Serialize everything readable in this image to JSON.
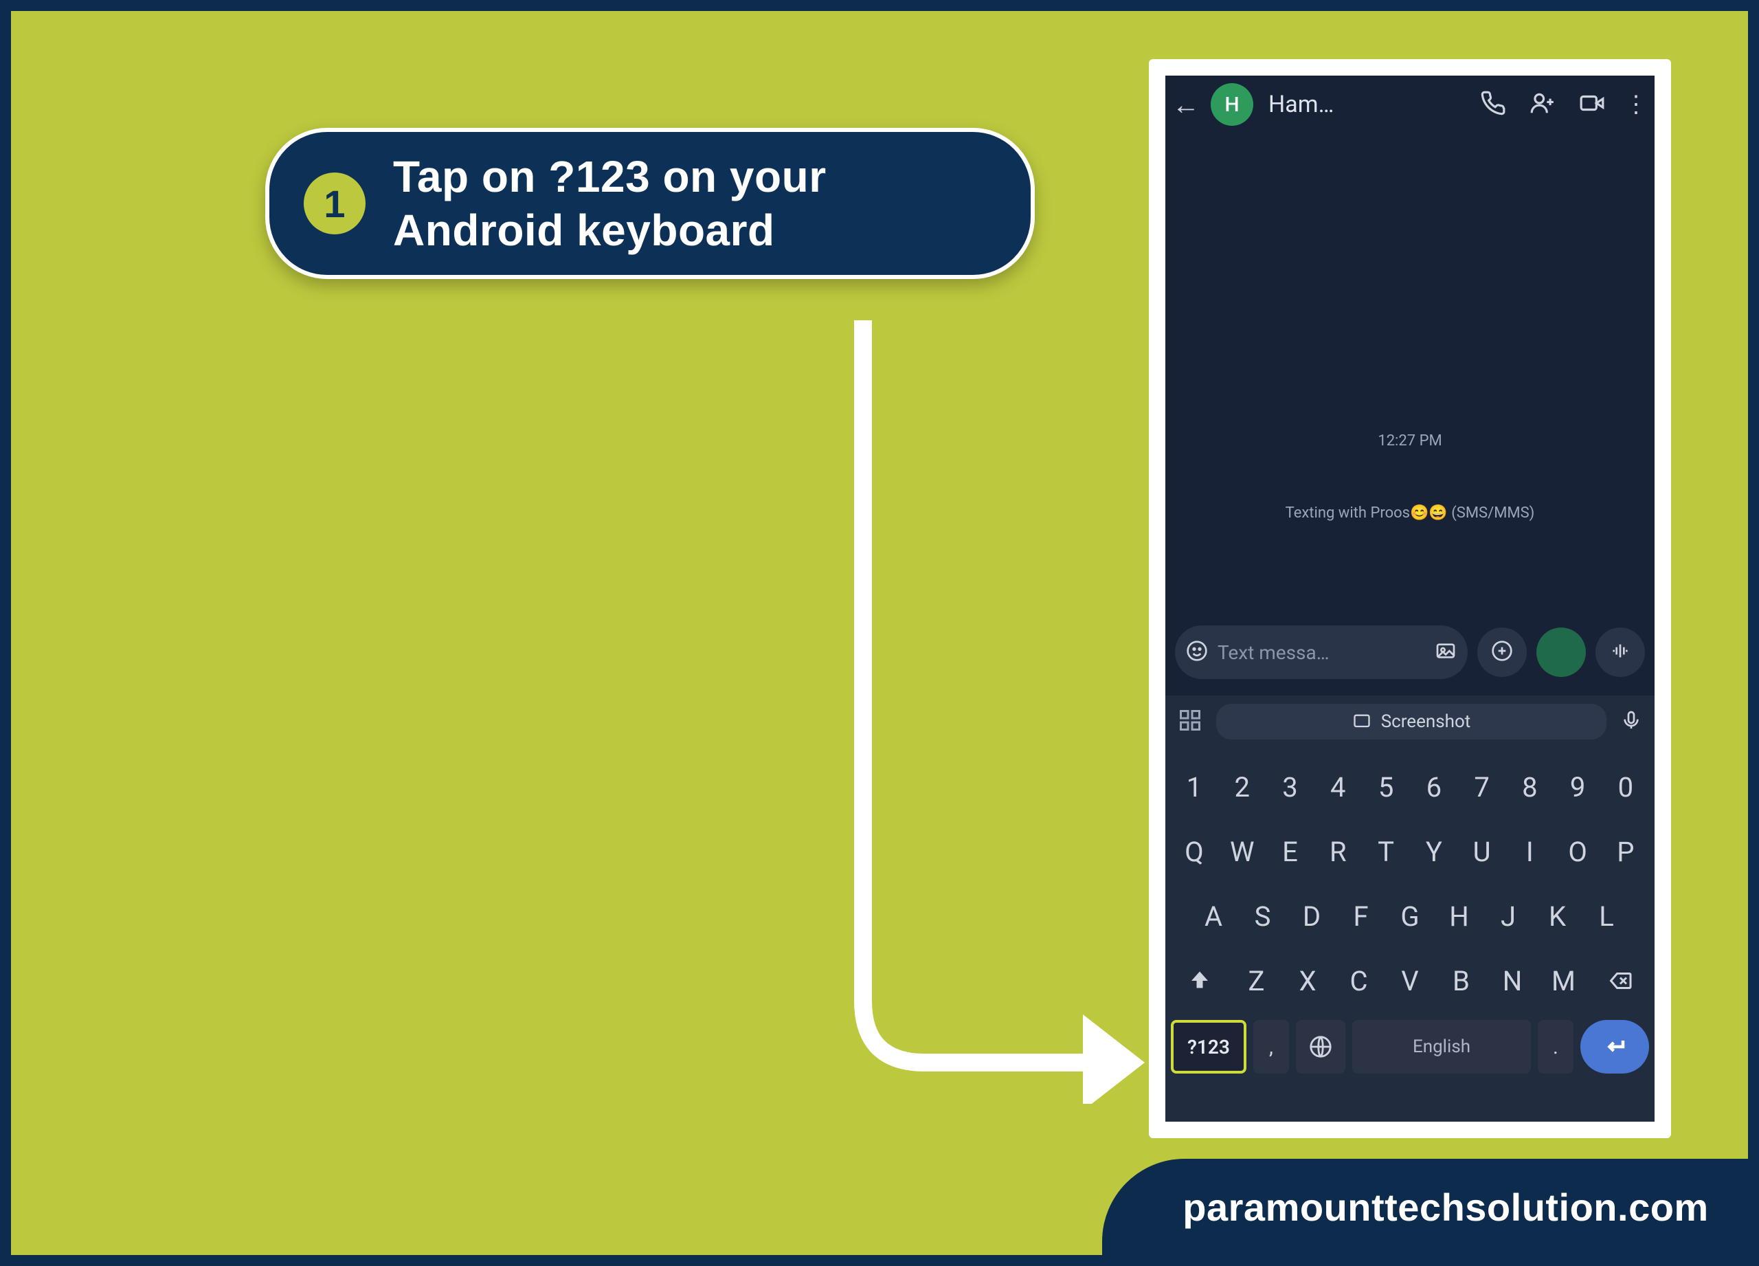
{
  "instruction": {
    "step_number": "1",
    "text": "Tap on ?123 on your Android keyboard"
  },
  "phone": {
    "topbar": {
      "avatar_initial": "H",
      "contact_name": "Ham…"
    },
    "conversation": {
      "timestamp": "12:27 PM",
      "subtitle": "Texting with Proos😊😄 (SMS/MMS)"
    },
    "input": {
      "placeholder": "Text messa…"
    },
    "suggestion_chip": "Screenshot",
    "keyboard": {
      "row_numbers": [
        "1",
        "2",
        "3",
        "4",
        "5",
        "6",
        "7",
        "8",
        "9",
        "0"
      ],
      "row_q": [
        "Q",
        "W",
        "E",
        "R",
        "T",
        "Y",
        "U",
        "I",
        "O",
        "P"
      ],
      "row_a": [
        "A",
        "S",
        "D",
        "F",
        "G",
        "H",
        "J",
        "K",
        "L"
      ],
      "row_z": [
        "Z",
        "X",
        "C",
        "V",
        "B",
        "N",
        "M"
      ],
      "symbols_key": "?123",
      "comma_key": ",",
      "space_label": "English",
      "period_key": "."
    }
  },
  "footer": {
    "site": "paramounttechsolution.com"
  }
}
